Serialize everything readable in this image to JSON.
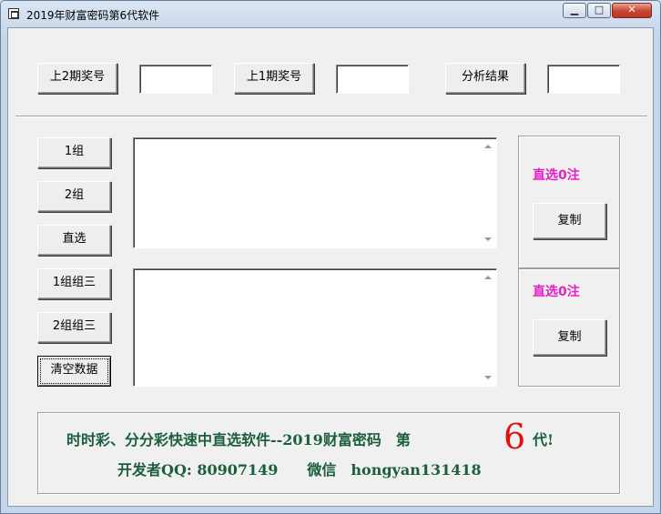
{
  "window": {
    "title": "2019年财富密码第6代软件",
    "controls": {
      "minimize": "▁",
      "maximize": "□",
      "close": "✕"
    }
  },
  "top_row": {
    "prev2_label": "上2期奖号",
    "prev2_value": "",
    "prev1_label": "上1期奖号",
    "prev1_value": "",
    "analyze_label": "分析结果",
    "analyze_value": ""
  },
  "left_buttons": {
    "group1": "1组",
    "group2": "2组",
    "direct": "直选",
    "group1_three": "1组组三",
    "group2_three": "2组组三",
    "clear": "清空数据"
  },
  "upper_panel": {
    "count_text": "直选0注",
    "copy_label": "复制",
    "text": ""
  },
  "lower_panel": {
    "count_text": "直选0注",
    "copy_label": "复制",
    "text": ""
  },
  "banner": {
    "line1": "时时彩、分分彩快速中直选软件--2019财富密码　第",
    "big_number": "6",
    "line1_suffix": "代!",
    "line2_prefix": "开发者QQ: 80907149　　微信　hongyan131418"
  },
  "colors": {
    "count_magenta": "#e020c8",
    "banner_green": "#1a5e3c",
    "big_number_red": "#e01010"
  }
}
